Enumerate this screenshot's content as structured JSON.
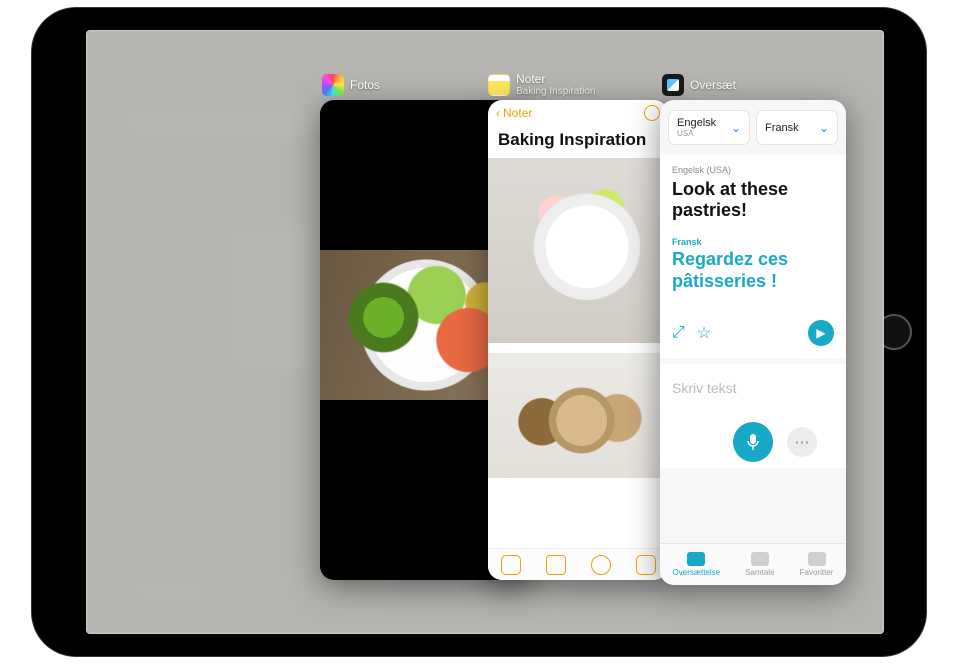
{
  "switcher": {
    "photos": {
      "app_name": "Fotos"
    },
    "notes": {
      "app_name": "Noter",
      "subtitle": "Baking Inspiration",
      "back_label": "Noter",
      "title": "Baking Inspiration"
    },
    "translate": {
      "app_name": "Oversæt",
      "source_lang": "Engelsk",
      "source_lang_sub": "USA",
      "target_lang": "Fransk",
      "source_label": "Engelsk (USA)",
      "source_text": "Look at these pastries!",
      "target_label": "Fransk",
      "target_text": "Regardez ces pâtisseries !",
      "input_placeholder": "Skriv tekst",
      "tabs": {
        "translate": "Oversættelse",
        "conversation": "Samtale",
        "favorites": "Favoritter"
      }
    }
  }
}
